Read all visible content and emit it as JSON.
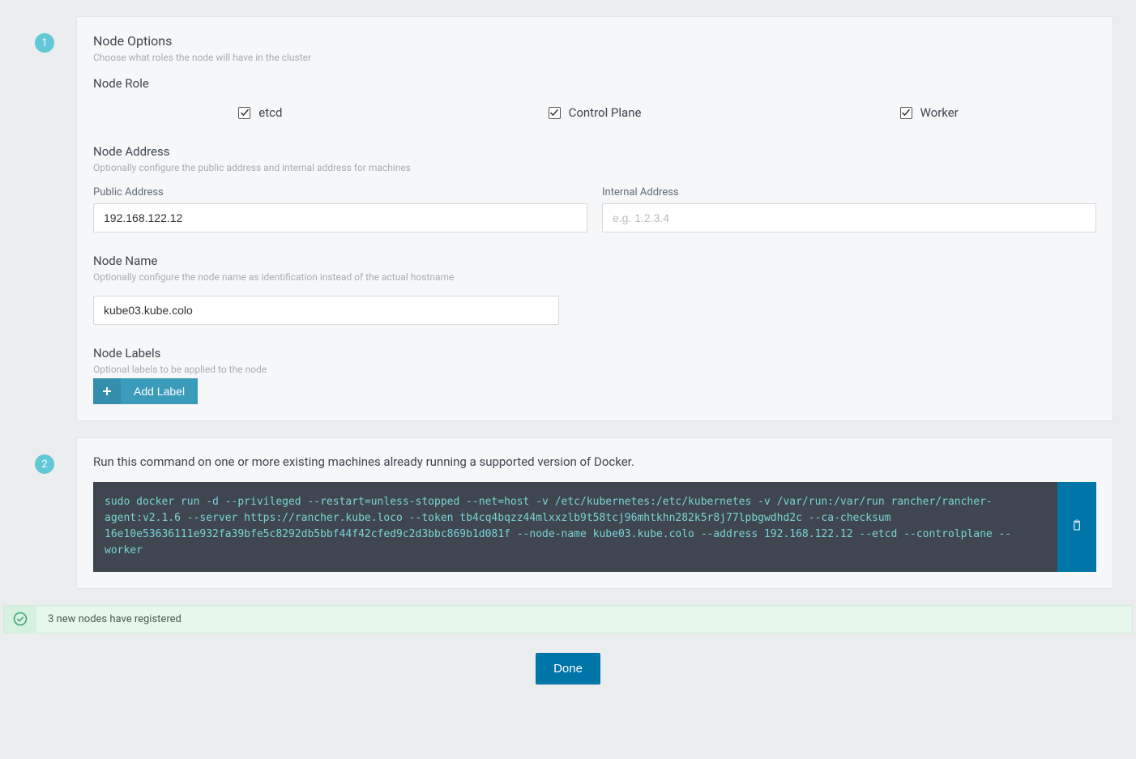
{
  "step1": {
    "badge": "1",
    "title": "Node Options",
    "subtitle": "Choose what roles the node will have in the cluster",
    "role_heading": "Node Role",
    "roles": {
      "etcd": "etcd",
      "controlplane": "Control Plane",
      "worker": "Worker"
    },
    "address": {
      "heading": "Node Address",
      "subtitle": "Optionally configure the public address and internal address for machines",
      "public_label": "Public Address",
      "public_value": "192.168.122.12",
      "internal_label": "Internal Address",
      "internal_placeholder": "e.g. 1.2.3.4"
    },
    "name": {
      "heading": "Node Name",
      "subtitle": "Optionally configure the node name as identification instead of the actual hostname",
      "value": "kube03.kube.colo"
    },
    "labels": {
      "heading": "Node Labels",
      "subtitle": "Optional labels to be applied to the node",
      "button": "Add Label"
    }
  },
  "step2": {
    "badge": "2",
    "text": "Run this command on one or more existing machines already running a supported version of Docker.",
    "command": "sudo docker run -d --privileged --restart=unless-stopped --net=host -v /etc/kubernetes:/etc/kubernetes -v /var/run:/var/run rancher/rancher-agent:v2.1.6 --server https://rancher.kube.loco --token tb4cq4bqzz44mlxxzlb9t58tcj96mhtkhn282k5r8j77lpbgwdhd2c --ca-checksum 16e10e53636111e932fa39bfe5c8292db5bbf44f42cfed9c2d3bbc869b1d081f --node-name kube03.kube.colo --address 192.168.122.12 --etcd --controlplane --worker"
  },
  "status": {
    "text": "3 new nodes have registered"
  },
  "done_button": "Done"
}
